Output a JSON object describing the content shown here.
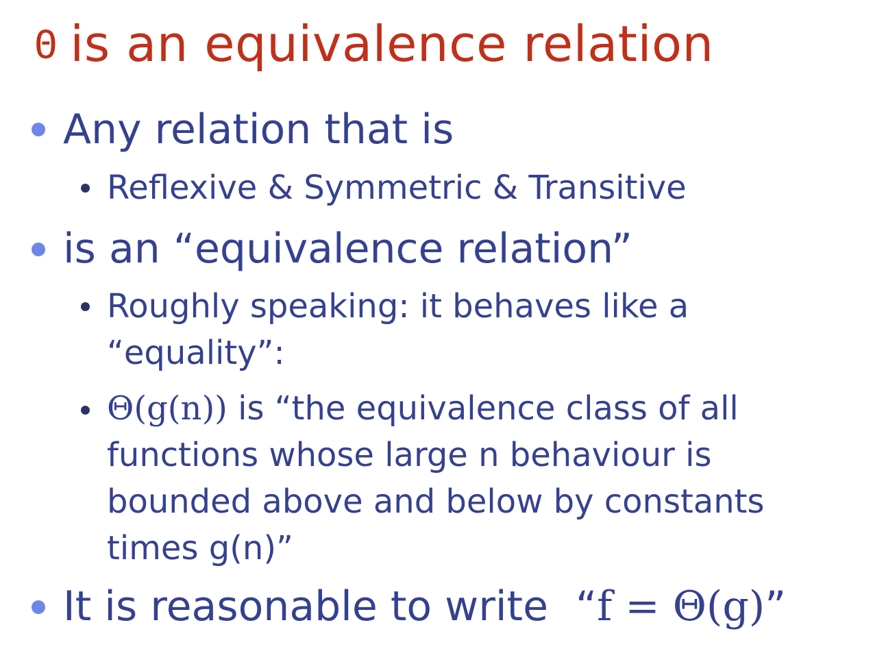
{
  "slide": {
    "title": {
      "theta_symbol": "Θ",
      "text": "is an equivalence relation"
    },
    "bullets": [
      {
        "text": "Any relation that is"
      },
      {
        "text": "Reflexive & Symmetric  & Transitive"
      },
      {
        "text": "is an “equivalence relation”"
      },
      {
        "lines": [
          "Roughly speaking: it behaves like a",
          "“equality”:"
        ]
      },
      {
        "math_prefix": "Θ(g(n))",
        "lines": [
          " is “the equivalence class of all",
          "functions whose large n behaviour is",
          "bounded above and below by constants",
          "times g(n)”"
        ]
      },
      {
        "text": "It is reasonable to write",
        "formula_open_quote": "“",
        "formula": "f = Θ(g)",
        "formula_close_quote": "”"
      }
    ]
  },
  "colors": {
    "title": "#c0301a",
    "body_text": "#35418f",
    "level1_bullet": "#6f86e8",
    "level2_bullet": "#2b3366"
  }
}
